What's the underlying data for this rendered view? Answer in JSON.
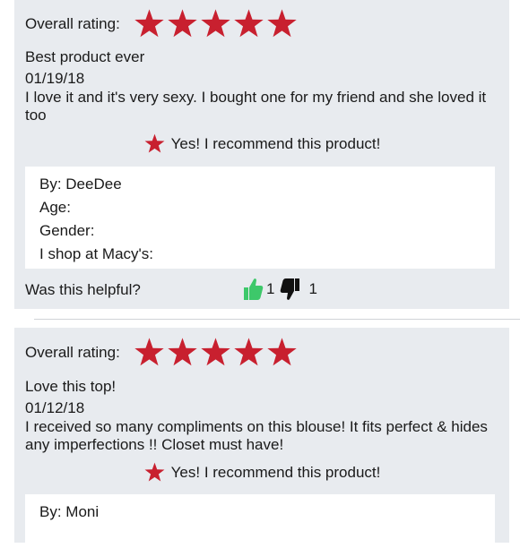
{
  "accent_color": "#c8202f",
  "thumb_up_color": "#3dc86a",
  "reviews": [
    {
      "rating_label": "Overall rating:",
      "stars": 5,
      "title": "Best product ever",
      "date": "01/19/18",
      "body": "I love it and it's very sexy.  I bought one for my friend and she loved it too",
      "recommend": "Yes! I recommend this product!",
      "by": "By: DeeDee",
      "age": "Age:",
      "gender": "Gender:",
      "shop": "I shop at Macy's:",
      "helpful_label": "Was this helpful?",
      "up_count": "1",
      "down_count": "1"
    },
    {
      "rating_label": "Overall rating:",
      "stars": 5,
      "title": "Love this top!",
      "date": "01/12/18",
      "body": "I received so many compliments on this blouse! It fits perfect & hides any imperfections !! Closet must have!",
      "recommend": "Yes! I recommend this product!",
      "by": "By: Moni"
    }
  ]
}
